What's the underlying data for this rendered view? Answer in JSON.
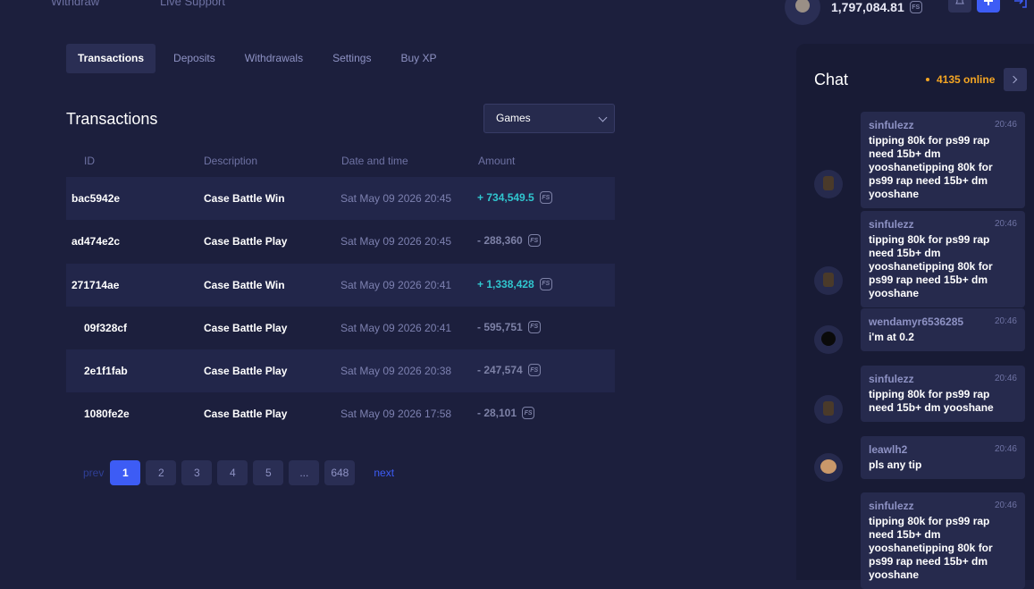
{
  "topnav": {
    "withdraw": "Withdraw",
    "support": "Live Support"
  },
  "user": {
    "balance": "1,797,084.81"
  },
  "tabs": [
    "Transactions",
    "Deposits",
    "Withdrawals",
    "Settings",
    "Buy XP"
  ],
  "section_title": "Transactions",
  "filter": {
    "selected": "Games"
  },
  "table": {
    "headers": [
      "ID",
      "Description",
      "Date and time",
      "Amount"
    ],
    "rows": [
      {
        "id": "bac5942e",
        "description": "Case Battle Win",
        "date": "Sat May 09 2026 20:45",
        "amount": "+ 734,549.5"
      },
      {
        "id": "ad474e2c",
        "description": "Case Battle Play",
        "date": "Sat May 09 2026 20:45",
        "amount": "- 288,360"
      },
      {
        "id": "271714ae",
        "description": "Case Battle Win",
        "date": "Sat May 09 2026 20:41",
        "amount": "+ 1,338,428"
      },
      {
        "id": "09f328cf",
        "description": "Case Battle Play",
        "date": "Sat May 09 2026 20:41",
        "amount": "- 595,751"
      },
      {
        "id": "2e1f1fab",
        "description": "Case Battle Play",
        "date": "Sat May 09 2026 20:38",
        "amount": "- 247,574"
      },
      {
        "id": "1080fe2e",
        "description": "Case Battle Play",
        "date": "Sat May 09 2026 17:58",
        "amount": "- 28,101"
      }
    ]
  },
  "coin_label": "FS",
  "pagination": {
    "prev": "prev",
    "pages": [
      "1",
      "2",
      "3",
      "4",
      "5",
      "...",
      "648"
    ],
    "next": "next"
  },
  "chat": {
    "title": "Chat",
    "online": "4135 online",
    "messages": [
      {
        "user": "sinfulezz",
        "time": "20:46",
        "text": "tipping 80k for ps99 rap need 15b+ dm yooshanetipping 80k for ps99 rap need 15b+ dm yooshane"
      },
      {
        "user": "sinfulezz",
        "time": "20:46",
        "text": "tipping 80k for ps99 rap need 15b+ dm yooshanetipping 80k for ps99 rap need 15b+ dm yooshane"
      },
      {
        "user": "wendamyr6536285",
        "time": "20:46",
        "text": "i'm at 0.2"
      },
      {
        "user": "sinfulezz",
        "time": "20:46",
        "text": "tipping 80k for ps99 rap need 15b+ dm yooshane"
      },
      {
        "user": "leawlh2",
        "time": "20:46",
        "text": "pls any tip"
      },
      {
        "user": "sinfulezz",
        "time": "20:46",
        "text": "tipping 80k for ps99 rap need 15b+ dm yooshanetipping 80k for ps99 rap need 15b+ dm yooshane"
      }
    ]
  },
  "colors": {
    "accent": "#3d5cf5",
    "positive": "#30c6cf",
    "online": "#f5a623"
  }
}
